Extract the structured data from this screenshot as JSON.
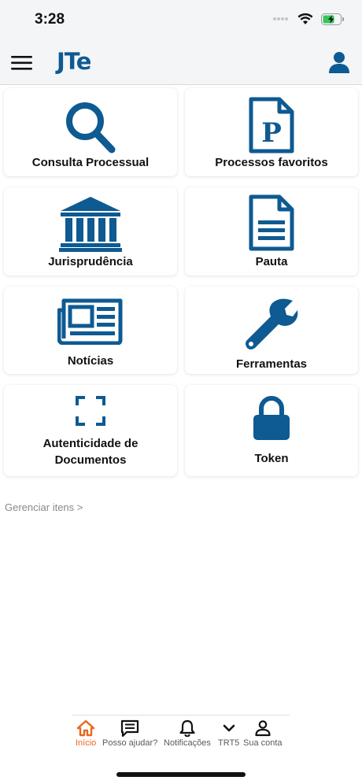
{
  "status_bar": {
    "time": "3:28",
    "icons": [
      "signal-icon",
      "wifi-icon",
      "battery-charging-icon"
    ]
  },
  "header": {
    "logo_text": "JTe",
    "menu_icon": "hamburger-menu-icon",
    "profile_icon": "user-profile-icon"
  },
  "tiles": [
    {
      "label": "Consulta Processual",
      "icon": "search-icon"
    },
    {
      "label": "Processos favoritos",
      "icon": "document-p-icon"
    },
    {
      "label": "Jurisprudência",
      "icon": "courthouse-icon"
    },
    {
      "label": "Pauta",
      "icon": "document-icon"
    },
    {
      "label": "Notícias",
      "icon": "newspaper-icon"
    },
    {
      "label": "Ferramentas",
      "icon": "wrench-icon"
    },
    {
      "label": "Autenticidade de Documentos",
      "line1": "Autenticidade de",
      "line2": "Documentos",
      "icon": "scan-frame-icon"
    },
    {
      "label": "Token",
      "icon": "padlock-icon"
    }
  ],
  "manage_items_label": "Gerenciar itens >",
  "tabbar": {
    "items": [
      {
        "label": "Início",
        "icon": "home-icon",
        "active": true
      },
      {
        "label": "Posso ajudar?",
        "icon": "chat-icon",
        "active": false
      },
      {
        "label": "Notificações",
        "icon": "bell-icon",
        "active": false
      },
      {
        "label": "TRT5",
        "icon": "chevron-down-icon",
        "active": false
      },
      {
        "label": "Sua conta",
        "icon": "account-icon",
        "active": false
      }
    ]
  },
  "colors": {
    "brand_blue": "#0e5a92",
    "active_orange": "#e8681f",
    "background": "#f4f5f7"
  }
}
